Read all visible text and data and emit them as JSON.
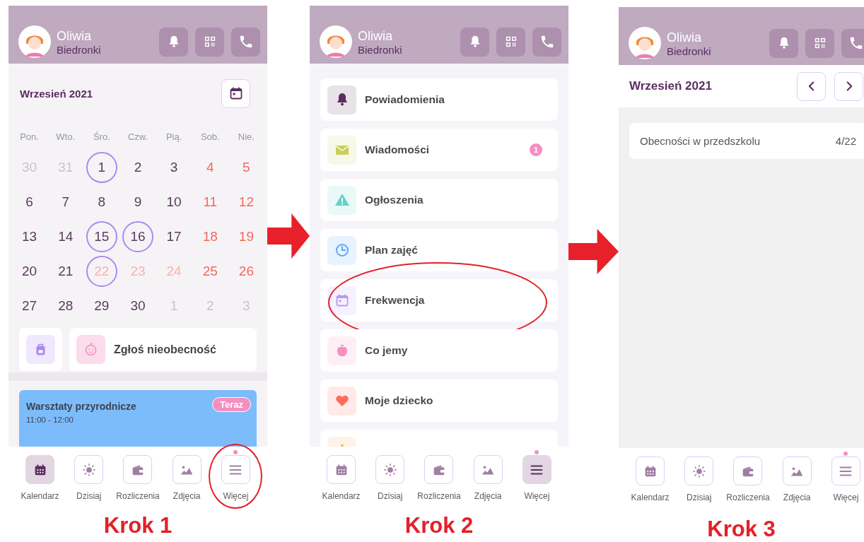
{
  "steps": [
    {
      "label": "Krok 1",
      "screen": {
        "kind": "calendar",
        "header": {
          "name": "Oliwia",
          "group": "Biedronki"
        },
        "calendar": {
          "title": "Wrzesień 2021",
          "weekdays": [
            "Pon.",
            "Wto.",
            "Śro.",
            "Czw.",
            "Pią.",
            "Sob.",
            "Nie."
          ],
          "weeks": [
            [
              {
                "day": "30",
                "kind": "muted",
                "circled": false
              },
              {
                "day": "31",
                "kind": "muted",
                "circled": false
              },
              {
                "day": "1",
                "kind": "normal",
                "circled": true
              },
              {
                "day": "2",
                "kind": "normal",
                "circled": false
              },
              {
                "day": "3",
                "kind": "normal",
                "circled": false
              },
              {
                "day": "4",
                "kind": "weekend",
                "circled": false
              },
              {
                "day": "5",
                "kind": "weekend",
                "circled": false
              }
            ],
            [
              {
                "day": "6",
                "kind": "normal",
                "circled": false
              },
              {
                "day": "7",
                "kind": "normal",
                "circled": false
              },
              {
                "day": "8",
                "kind": "normal",
                "circled": false
              },
              {
                "day": "9",
                "kind": "normal",
                "circled": false
              },
              {
                "day": "10",
                "kind": "normal",
                "circled": false
              },
              {
                "day": "11",
                "kind": "weekend",
                "circled": false
              },
              {
                "day": "12",
                "kind": "weekend",
                "circled": false
              }
            ],
            [
              {
                "day": "13",
                "kind": "normal",
                "circled": false
              },
              {
                "day": "14",
                "kind": "normal",
                "circled": false
              },
              {
                "day": "15",
                "kind": "normal",
                "circled": true
              },
              {
                "day": "16",
                "kind": "normal",
                "circled": true
              },
              {
                "day": "17",
                "kind": "normal",
                "circled": false
              },
              {
                "day": "18",
                "kind": "weekend",
                "circled": false
              },
              {
                "day": "19",
                "kind": "weekend",
                "circled": false
              }
            ],
            [
              {
                "day": "20",
                "kind": "normal",
                "circled": false
              },
              {
                "day": "21",
                "kind": "normal",
                "circled": false
              },
              {
                "day": "22",
                "kind": "light",
                "circled": true
              },
              {
                "day": "23",
                "kind": "light",
                "circled": false
              },
              {
                "day": "24",
                "kind": "light",
                "circled": false
              },
              {
                "day": "25",
                "kind": "weekend",
                "circled": false
              },
              {
                "day": "26",
                "kind": "weekend",
                "circled": false
              }
            ],
            [
              {
                "day": "27",
                "kind": "normal",
                "circled": false
              },
              {
                "day": "28",
                "kind": "normal",
                "circled": false
              },
              {
                "day": "29",
                "kind": "normal",
                "circled": false
              },
              {
                "day": "30",
                "kind": "normal",
                "circled": false
              },
              {
                "day": "1",
                "kind": "muted",
                "circled": false
              },
              {
                "day": "2",
                "kind": "muted",
                "circled": false
              },
              {
                "day": "3",
                "kind": "muted",
                "circled": false
              }
            ]
          ]
        },
        "absence_label": "Zgłoś nieobecność",
        "event": {
          "title": "Warsztaty przyrodnicze",
          "time": "11:00 - 12:00",
          "badge": "Teraz"
        },
        "nav": [
          {
            "kind": "calendar",
            "label": "Kalendarz",
            "selected": true,
            "dot": false,
            "highlighted": false
          },
          {
            "kind": "sun",
            "label": "Dzisiaj",
            "selected": false,
            "dot": false,
            "highlighted": false
          },
          {
            "kind": "wallet",
            "label": "Rozliczenia",
            "selected": false,
            "dot": false,
            "highlighted": false
          },
          {
            "kind": "image",
            "label": "Zdjęcia",
            "selected": false,
            "dot": false,
            "highlighted": false
          },
          {
            "kind": "menu",
            "label": "Więcej",
            "selected": false,
            "dot": true,
            "highlighted": true
          }
        ]
      }
    },
    {
      "label": "Krok 2",
      "screen": {
        "kind": "menu",
        "header": {
          "name": "Oliwia",
          "group": "Biedronki"
        },
        "items": [
          {
            "kind": "bell",
            "color": "#5b2d61",
            "label": "Powiadomienia",
            "highlighted": false
          },
          {
            "kind": "envelope",
            "color": "#c6d05a",
            "label": "Wiadomości",
            "badge": "1",
            "highlighted": false
          },
          {
            "kind": "warning",
            "color": "#5fd3c9",
            "label": "Ogłoszenia",
            "highlighted": false
          },
          {
            "kind": "clock",
            "color": "#5aa8f5",
            "label": "Plan zajęć",
            "highlighted": false
          },
          {
            "kind": "calendar",
            "color": "#b79af5",
            "label": "Frekwencja",
            "highlighted": true
          },
          {
            "kind": "apple",
            "color": "#f58fc4",
            "label": "Co jemy",
            "highlighted": false
          },
          {
            "kind": "heart",
            "color": "#ff6b5a",
            "label": "Moje dziecko",
            "highlighted": false
          },
          {
            "kind": "gear",
            "color": "#f5a84c",
            "highlighted": false
          }
        ],
        "nav": [
          {
            "kind": "calendar",
            "label": "Kalendarz",
            "selected": false,
            "dot": false,
            "highlighted": false
          },
          {
            "kind": "sun",
            "label": "Dzisiaj",
            "selected": false,
            "dot": false,
            "highlighted": false
          },
          {
            "kind": "wallet",
            "label": "Rozliczenia",
            "selected": false,
            "dot": false,
            "highlighted": false
          },
          {
            "kind": "image",
            "label": "Zdjęcia",
            "selected": false,
            "dot": false,
            "highlighted": false
          },
          {
            "kind": "menu",
            "label": "Więcej",
            "selected": true,
            "dot": true,
            "highlighted": false
          }
        ]
      }
    },
    {
      "label": "Krok 3",
      "screen": {
        "kind": "attendance",
        "header": {
          "name": "Oliwia",
          "group": "Biedronki"
        },
        "title": "Wrzesień 2021",
        "rows": [
          {
            "label": "Obecności w przedszkolu",
            "value": "4/22"
          }
        ],
        "nav": [
          {
            "kind": "calendar",
            "label": "Kalendarz",
            "selected": false,
            "dot": false,
            "highlighted": false
          },
          {
            "kind": "sun",
            "label": "Dzisiaj",
            "selected": false,
            "dot": false,
            "highlighted": false
          },
          {
            "kind": "wallet",
            "label": "Rozliczenia",
            "selected": false,
            "dot": false,
            "highlighted": false
          },
          {
            "kind": "image",
            "label": "Zdjęcia",
            "selected": false,
            "dot": false,
            "highlighted": false
          },
          {
            "kind": "menu",
            "label": "Więcej",
            "selected": false,
            "dot": true,
            "highlighted": false
          }
        ]
      }
    }
  ]
}
